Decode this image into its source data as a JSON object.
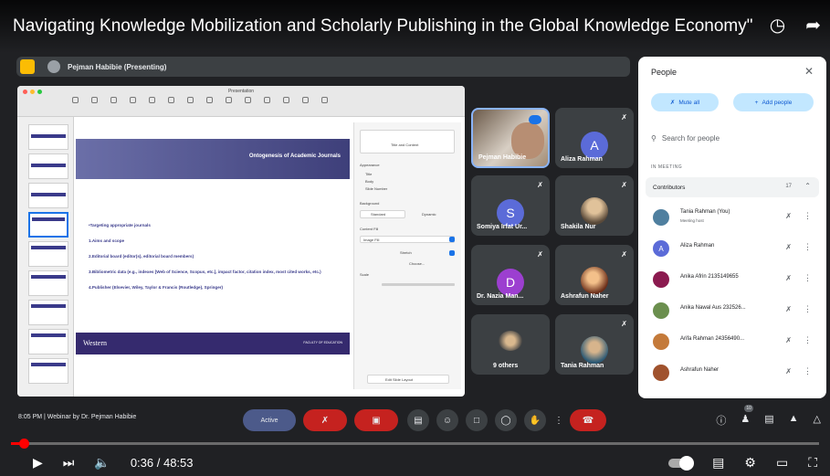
{
  "video": {
    "title": "Navigating Knowledge Mobilization and Scholarly Publishing in the Global Knowledge Economy\"",
    "current_time": "0:36",
    "duration": "48:53",
    "time_display": "0:36 / 48:53",
    "progress": 0.012
  },
  "meet": {
    "presenter_label": "Pejman Habibie (Presenting)",
    "clock": "8:05 PM",
    "meeting_name": "Webinar by Dr. Pejman Habibie",
    "clock_line": "8:05 PM  |  Webinar by Dr. Pejman Habibie",
    "active_label": "Active",
    "people_count": "10"
  },
  "slide": {
    "app_title": "Presentation",
    "header": "Ontogenesis of Academic Journals",
    "bullets": [
      "•Targeting appropriate journals",
      "1.Aims and scope",
      "2.Editorial board (editor(s), editorial board members)",
      "3.Bibliometric data (e.g., indexes [Web of Science, Scopus, etc.], impact factor, citation index, most cited works, etc.)",
      "4.Publisher (Elsevier, Wiley, Taylor & Francis (Routledge), Springer)"
    ],
    "footer_logo": "Western",
    "footer_right": "FACULTY OF EDUCATION",
    "inspector": {
      "layout_label": "Title and Content",
      "appearance": "Appearance",
      "title": "Title",
      "body": "Body",
      "slide_number": "Slide Number",
      "background": "Background",
      "standard": "Standard",
      "dynamic": "Dynamic",
      "content_fill": "Content Fill",
      "image_fill": "Image Fill",
      "stretch": "Stretch",
      "choose": "Choose...",
      "scale": "Scale",
      "edit_slide_layout": "Edit Slide Layout"
    }
  },
  "tiles": [
    {
      "name": "Pejman Habibie",
      "type": "video"
    },
    {
      "name": "Aliza Rahman",
      "initial": "A",
      "color": "#5b6bd8"
    },
    {
      "name": "Somiya Irfat Ur...",
      "initial": "S",
      "color": "#5b6bd8"
    },
    {
      "name": "Shakila Nur",
      "initial": "",
      "color": "#c9a56e"
    },
    {
      "name": "Dr. Nazia Man...",
      "initial": "D",
      "color": "#9c3fd0"
    },
    {
      "name": "Ashrafun Naher",
      "initial": "",
      "color": "#a0522d"
    },
    {
      "name": "9 others",
      "initial": "",
      "color": "#777"
    },
    {
      "name": "Tania Rahman",
      "initial": "",
      "color": "#4f7f9f"
    }
  ],
  "people_panel": {
    "title": "People",
    "mute_all": "Mute all",
    "add_people": "Add people",
    "search_placeholder": "Search for people",
    "section_label": "IN MEETING",
    "contributors_label": "Contributors",
    "contributors_count": "17",
    "participants": [
      {
        "name": "Tania Rahman (You)",
        "sub": "Meeting host",
        "initial": "",
        "color": "#4f7f9f"
      },
      {
        "name": "Aliza Rahman",
        "sub": "",
        "initial": "A",
        "color": "#5b6bd8"
      },
      {
        "name": "Anika Afrin 2135149655",
        "sub": "",
        "initial": "",
        "color": "#8b1a4f"
      },
      {
        "name": "Anika Nawal Aus 232526...",
        "sub": "",
        "initial": "",
        "color": "#6b8f4e"
      },
      {
        "name": "Arifa Rahman 24356490...",
        "sub": "",
        "initial": "",
        "color": "#c47a3a"
      },
      {
        "name": "Ashrafun Naher",
        "sub": "",
        "initial": "",
        "color": "#a0522d"
      }
    ]
  },
  "icons": {
    "watch_later": "clock-icon",
    "share": "share-arrow-icon",
    "close": "close-icon",
    "search": "search-icon",
    "mic_off": "mic-off-icon"
  }
}
